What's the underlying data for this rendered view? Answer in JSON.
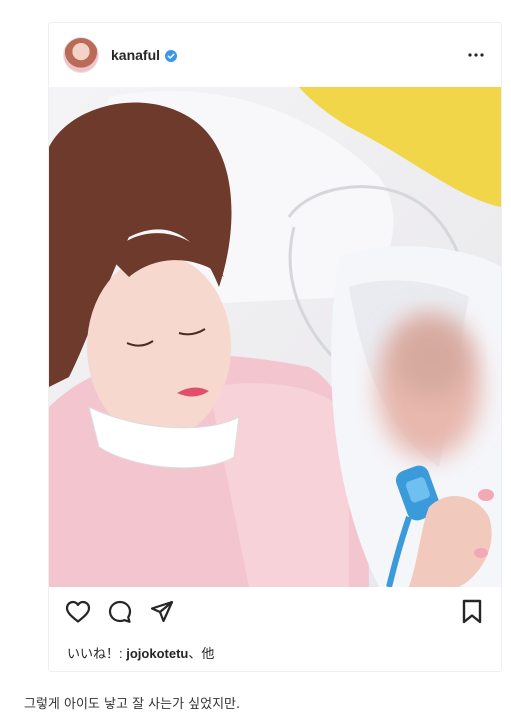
{
  "post": {
    "username": "kanaful",
    "likes_label": "いいね！: ",
    "likes_user": "jojokotetu",
    "likes_suffix": "、他"
  },
  "caption": "그렇게 아이도 낳고 잘 사는가 싶었지만.",
  "icons": {
    "avatar": "profile-avatar",
    "verified": "verified-badge-icon",
    "more": "more-options-icon",
    "like": "heart-icon",
    "comment": "comment-icon",
    "share": "share-icon",
    "save": "bookmark-icon"
  },
  "colors": {
    "verified_blue": "#3897f0",
    "text": "#262626"
  }
}
